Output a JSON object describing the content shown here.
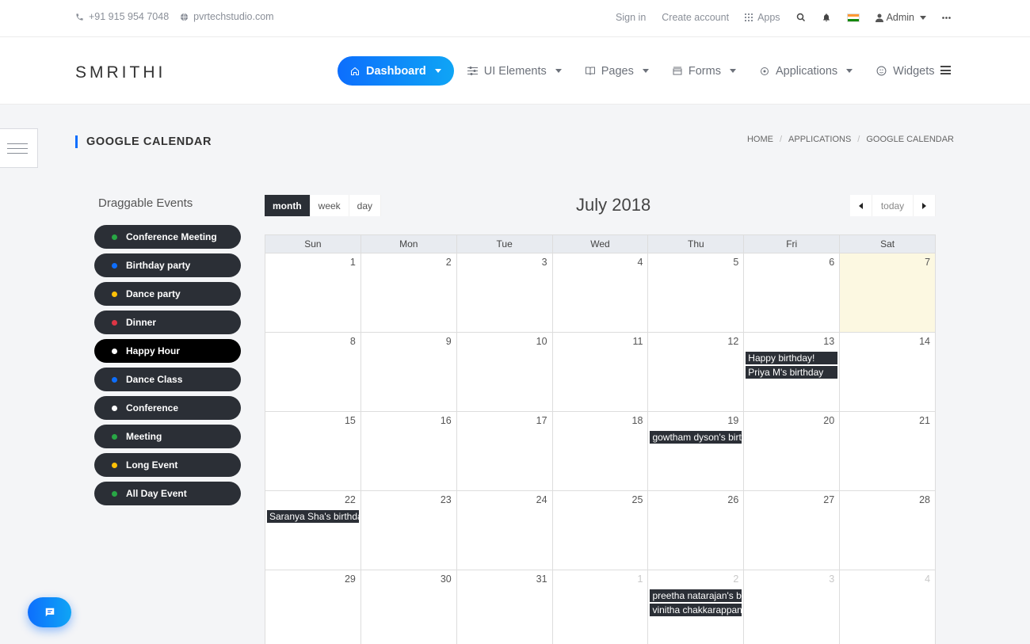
{
  "topbar": {
    "phone": "+91 915 954 7048",
    "website": "pvrtechstudio.com",
    "sign_in": "Sign in",
    "create_account": "Create account",
    "apps": "Apps",
    "admin": "Admin"
  },
  "header": {
    "logo": "SMRITHI",
    "nav": [
      {
        "label": "Dashboard",
        "icon": "home-icon"
      },
      {
        "label": "UI Elements",
        "icon": "sliders-icon"
      },
      {
        "label": "Pages",
        "icon": "book-icon"
      },
      {
        "label": "Forms",
        "icon": "form-icon"
      },
      {
        "label": "Applications",
        "icon": "apps-icon"
      },
      {
        "label": "Widgets",
        "icon": "widget-icon"
      }
    ]
  },
  "page": {
    "title": "GOOGLE CALENDAR",
    "breadcrumb": [
      "HOME",
      "APPLICATIONS",
      "GOOGLE CALENDAR"
    ]
  },
  "draggable": {
    "title": "Draggable Events",
    "events": [
      {
        "label": "Conference Meeting",
        "color": "#28a745"
      },
      {
        "label": "Birthday party",
        "color": "#0d6efd"
      },
      {
        "label": "Dance party",
        "color": "#ffc107"
      },
      {
        "label": "Dinner",
        "color": "#dc3545"
      },
      {
        "label": "Happy Hour",
        "color": "#ffffff"
      },
      {
        "label": "Dance Class",
        "color": "#0d6efd"
      },
      {
        "label": "Conference",
        "color": "#ffffff"
      },
      {
        "label": "Meeting",
        "color": "#28a745"
      },
      {
        "label": "Long Event",
        "color": "#ffc107"
      },
      {
        "label": "All Day Event",
        "color": "#28a745"
      }
    ]
  },
  "calendar": {
    "views": [
      "month",
      "week",
      "day"
    ],
    "title": "July 2018",
    "today": "today",
    "weekdays": [
      "Sun",
      "Mon",
      "Tue",
      "Wed",
      "Thu",
      "Fri",
      "Sat"
    ],
    "weeks": [
      [
        {
          "d": "1"
        },
        {
          "d": "2"
        },
        {
          "d": "3"
        },
        {
          "d": "4"
        },
        {
          "d": "5"
        },
        {
          "d": "6"
        },
        {
          "d": "7",
          "today": true
        }
      ],
      [
        {
          "d": "8"
        },
        {
          "d": "9"
        },
        {
          "d": "10"
        },
        {
          "d": "11"
        },
        {
          "d": "12"
        },
        {
          "d": "13",
          "events": [
            "Happy birthday!",
            "Priya M's birthday"
          ]
        },
        {
          "d": "14"
        }
      ],
      [
        {
          "d": "15"
        },
        {
          "d": "16"
        },
        {
          "d": "17"
        },
        {
          "d": "18"
        },
        {
          "d": "19",
          "events": [
            "gowtham dyson's birthday"
          ]
        },
        {
          "d": "20"
        },
        {
          "d": "21"
        }
      ],
      [
        {
          "d": "22",
          "events": [
            "Saranya Sha's birthday"
          ]
        },
        {
          "d": "23"
        },
        {
          "d": "24"
        },
        {
          "d": "25"
        },
        {
          "d": "26"
        },
        {
          "d": "27"
        },
        {
          "d": "28"
        }
      ],
      [
        {
          "d": "29"
        },
        {
          "d": "30"
        },
        {
          "d": "31"
        },
        {
          "d": "1",
          "other": true
        },
        {
          "d": "2",
          "other": true,
          "events": [
            "preetha natarajan's birthday",
            "vinitha chakkarappan"
          ]
        },
        {
          "d": "3",
          "other": true
        },
        {
          "d": "4",
          "other": true
        }
      ]
    ]
  },
  "colors": {
    "accent": "#0d6efd",
    "dark": "#2b2f36",
    "today": "#fcf8e1"
  }
}
